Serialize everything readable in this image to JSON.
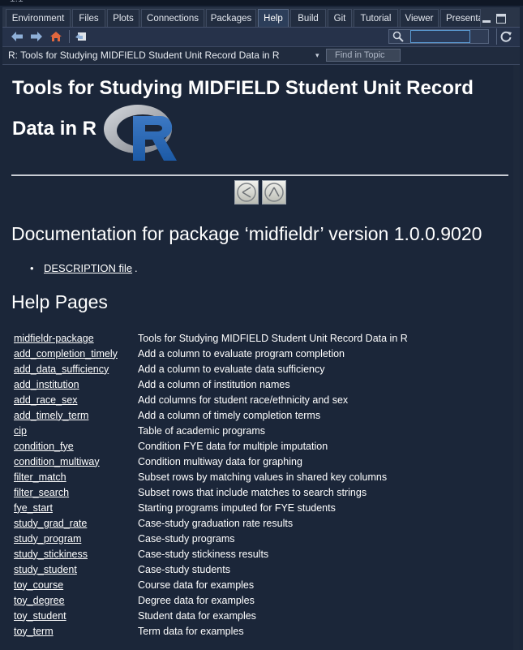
{
  "tabs": [
    {
      "label": "Environment"
    },
    {
      "label": "Files"
    },
    {
      "label": "Plots"
    },
    {
      "label": "Connections"
    },
    {
      "label": "Packages"
    },
    {
      "label": "Help"
    },
    {
      "label": "Build"
    },
    {
      "label": "Git"
    },
    {
      "label": "Tutorial"
    },
    {
      "label": "Viewer"
    },
    {
      "label": "Presentation"
    }
  ],
  "active_tab": "Help",
  "topic_bar": {
    "title": "R: Tools for Studying MIDFIELD Student Unit Record Data in R",
    "find_placeholder": "Find in Topic"
  },
  "page": {
    "title_line1": "Tools for Studying MIDFIELD Student Unit Record",
    "title_line2": "Data in R",
    "doc_heading": "Documentation for package ‘midfieldr’ version 1.0.0.9020",
    "description_link": "DESCRIPTION file",
    "description_suffix": ".",
    "help_heading": "Help Pages",
    "help_rows": [
      {
        "name": "midfieldr-package",
        "desc": "Tools for Studying MIDFIELD Student Unit Record Data in R"
      },
      {
        "name": "add_completion_timely",
        "desc": "Add a column to evaluate program completion"
      },
      {
        "name": "add_data_sufficiency",
        "desc": "Add a column to evaluate data sufficiency"
      },
      {
        "name": "add_institution",
        "desc": "Add a column of institution names"
      },
      {
        "name": "add_race_sex",
        "desc": "Add columns for student race/ethnicity and sex"
      },
      {
        "name": "add_timely_term",
        "desc": "Add a column of timely completion terms"
      },
      {
        "name": "cip",
        "desc": "Table of academic programs"
      },
      {
        "name": "condition_fye",
        "desc": "Condition FYE data for multiple imputation"
      },
      {
        "name": "condition_multiway",
        "desc": "Condition multiway data for graphing"
      },
      {
        "name": "filter_match",
        "desc": "Subset rows by matching values in shared key columns"
      },
      {
        "name": "filter_search",
        "desc": "Subset rows that include matches to search strings"
      },
      {
        "name": "fye_start",
        "desc": "Starting programs imputed for FYE students"
      },
      {
        "name": "study_grad_rate",
        "desc": "Case-study graduation rate results"
      },
      {
        "name": "study_program",
        "desc": "Case-study programs"
      },
      {
        "name": "study_stickiness",
        "desc": "Case-study stickiness results"
      },
      {
        "name": "study_student",
        "desc": "Case-study students"
      },
      {
        "name": "toy_course",
        "desc": "Course data for examples"
      },
      {
        "name": "toy_degree",
        "desc": "Degree data for examples"
      },
      {
        "name": "toy_student",
        "desc": "Student data for examples"
      },
      {
        "name": "toy_term",
        "desc": "Term data for examples"
      }
    ]
  },
  "colors": {
    "background": "#1b2639",
    "tab_active": "#2c3e5a",
    "text": "#ffffff"
  },
  "icons": [
    "back-arrow-icon",
    "forward-arrow-icon",
    "home-icon",
    "open-in-window-icon",
    "search-icon",
    "refresh-icon",
    "minimize-icon",
    "maximize-icon",
    "r-logo",
    "up-arrow-icon",
    "left-arrow-icon"
  ]
}
